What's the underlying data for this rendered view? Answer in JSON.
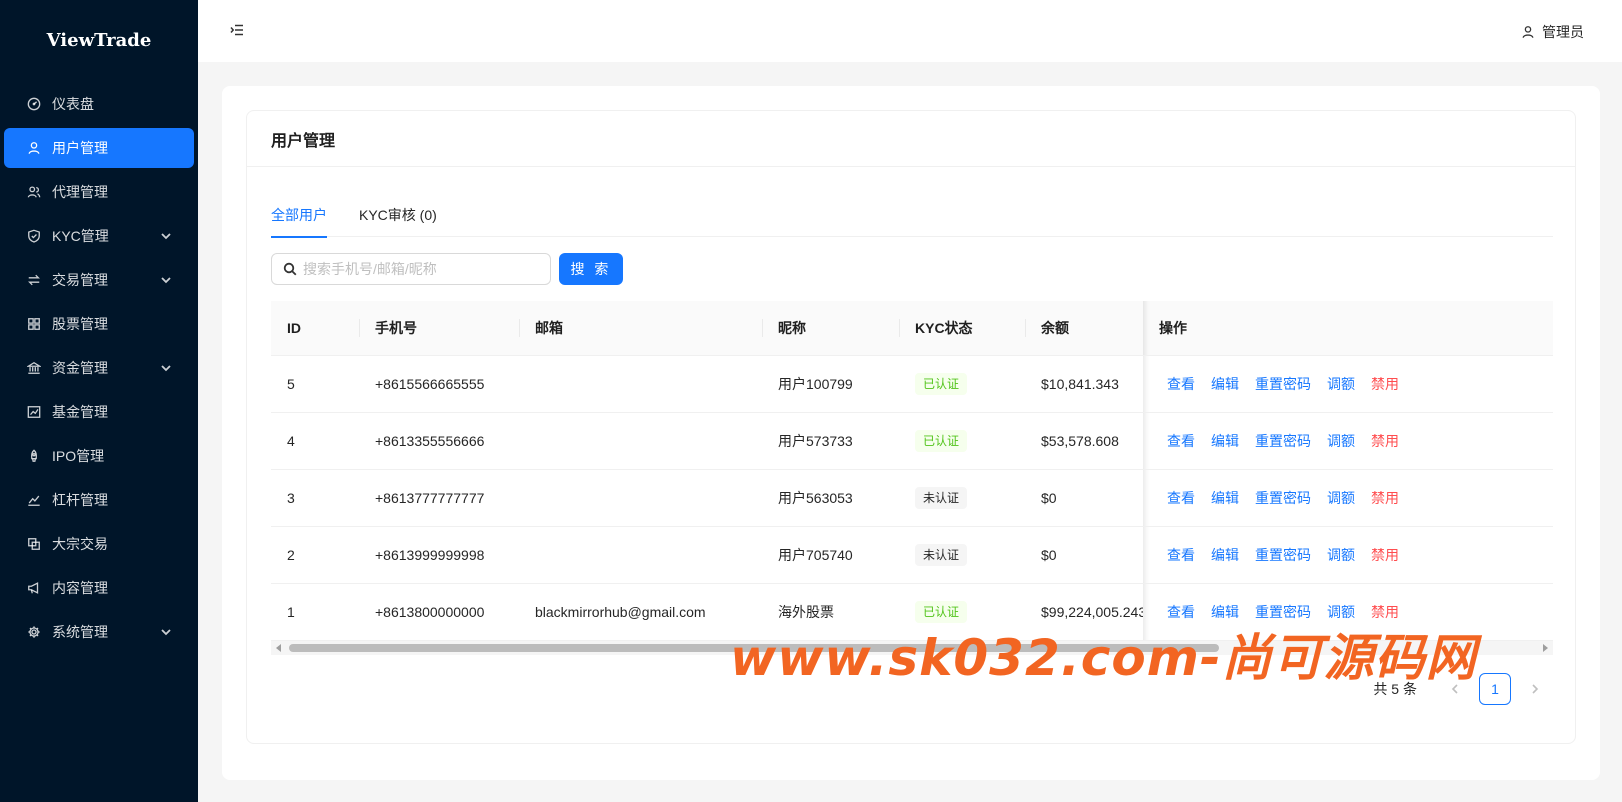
{
  "app": {
    "logo": "ViewTrade"
  },
  "sidebar": {
    "items": [
      {
        "label": "仪表盘",
        "icon": "dashboard-icon"
      },
      {
        "label": "用户管理",
        "icon": "user-icon",
        "active": true
      },
      {
        "label": "代理管理",
        "icon": "agent-icon"
      },
      {
        "label": "KYC管理",
        "icon": "shield-icon",
        "submenu": true
      },
      {
        "label": "交易管理",
        "icon": "swap-icon",
        "submenu": true
      },
      {
        "label": "股票管理",
        "icon": "grid-icon"
      },
      {
        "label": "资金管理",
        "icon": "bank-icon",
        "submenu": true
      },
      {
        "label": "基金管理",
        "icon": "fund-chart-icon"
      },
      {
        "label": "IPO管理",
        "icon": "rocket-icon"
      },
      {
        "label": "杠杆管理",
        "icon": "leverage-icon"
      },
      {
        "label": "大宗交易",
        "icon": "block-trade-icon"
      },
      {
        "label": "内容管理",
        "icon": "megaphone-icon"
      },
      {
        "label": "系统管理",
        "icon": "gear-icon",
        "submenu": true
      }
    ]
  },
  "header": {
    "user_label": "管理员"
  },
  "card": {
    "title": "用户管理"
  },
  "tabs": [
    {
      "label": "全部用户",
      "active": true
    },
    {
      "label": "KYC审核 (0)"
    }
  ],
  "search": {
    "placeholder": "搜索手机号/邮箱/昵称",
    "value": "",
    "button_label": "搜 索"
  },
  "table": {
    "columns": [
      "ID",
      "手机号",
      "邮箱",
      "昵称",
      "KYC状态",
      "余额",
      "操作"
    ],
    "rows": [
      {
        "id": "5",
        "phone": "+8615566665555",
        "email": "",
        "nickname": "用户100799",
        "kyc": "已认证",
        "balance": "$10,841.343"
      },
      {
        "id": "4",
        "phone": "+8613355556666",
        "email": "",
        "nickname": "用户573733",
        "kyc": "已认证",
        "balance": "$53,578.608"
      },
      {
        "id": "3",
        "phone": "+8613777777777",
        "email": "",
        "nickname": "用户563053",
        "kyc": "未认证",
        "balance": "$0"
      },
      {
        "id": "2",
        "phone": "+8613999999998",
        "email": "",
        "nickname": "用户705740",
        "kyc": "未认证",
        "balance": "$0"
      },
      {
        "id": "1",
        "phone": "+8613800000000",
        "email": "blackmirrorhub@gmail.com",
        "nickname": "海外股票",
        "kyc": "已认证",
        "balance": "$99,224,005.243"
      }
    ],
    "actions": [
      "查看",
      "编辑",
      "重置密码",
      "调额",
      "禁用"
    ]
  },
  "pagination": {
    "total": "共 5 条",
    "current": "1"
  },
  "watermark": "www.sk032.com-尚可源码网",
  "colors": {
    "primary": "#1677ff",
    "sidebar_bg": "#001529",
    "success": "#52c41a",
    "danger": "#ff4d4f",
    "watermark": "#f26522"
  }
}
